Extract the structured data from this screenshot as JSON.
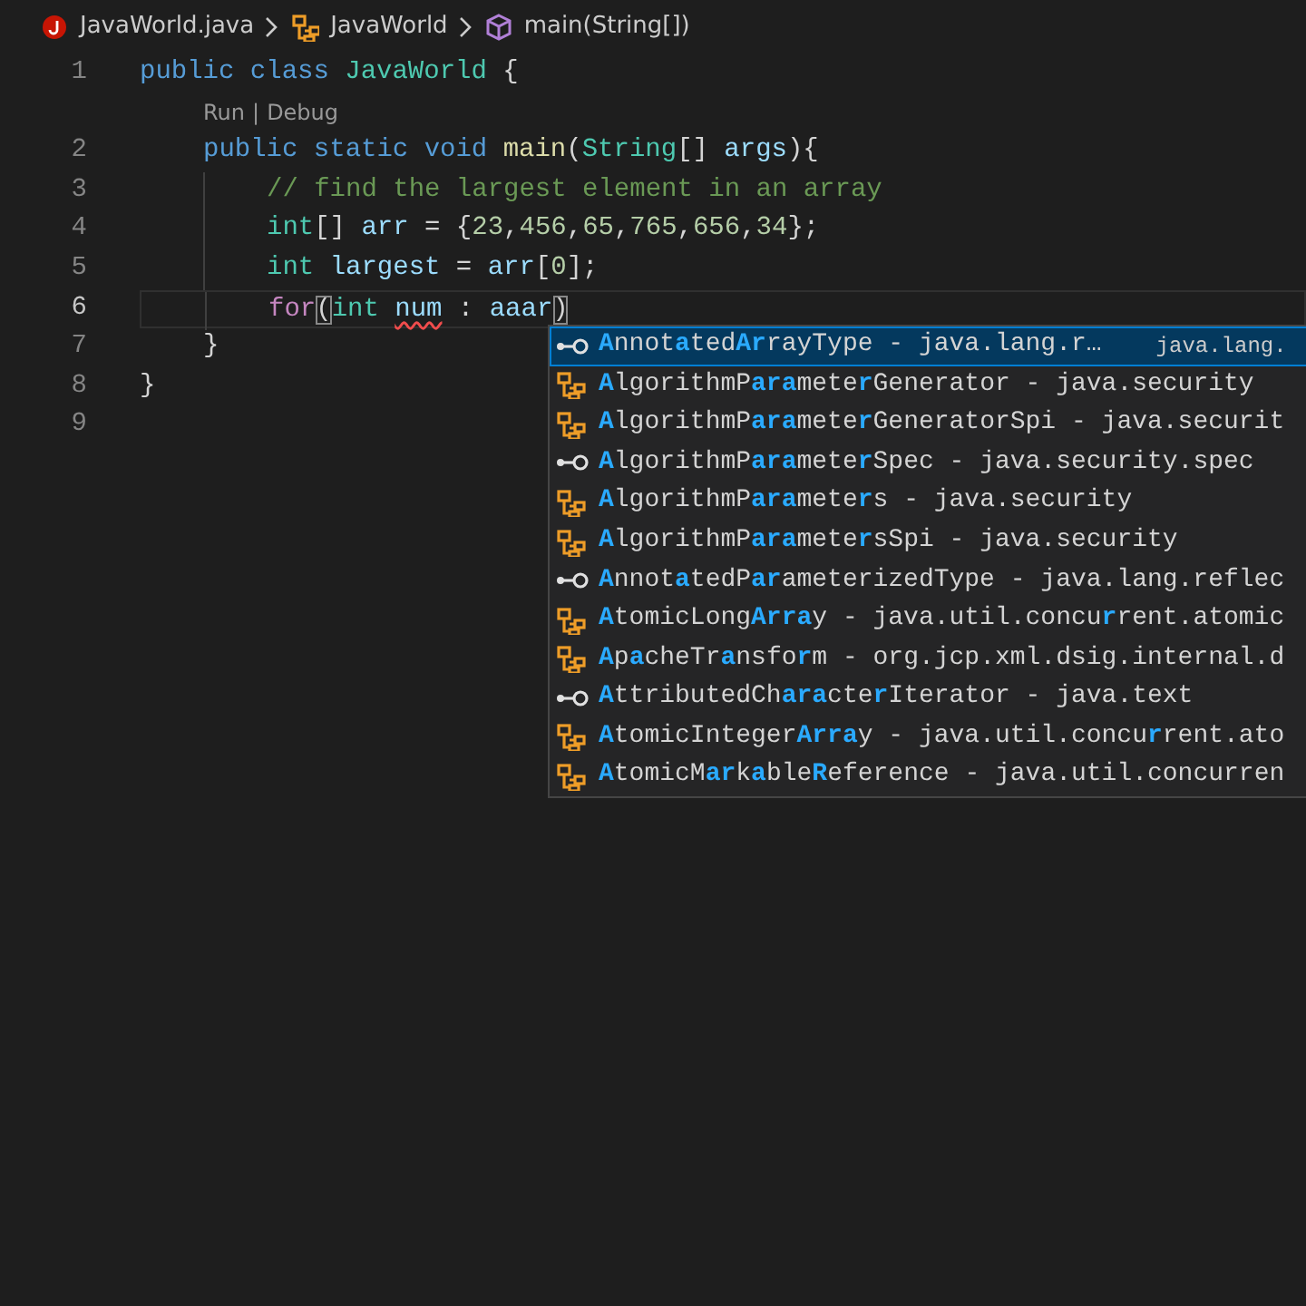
{
  "breadcrumb": [
    {
      "kind": "file",
      "label": "JavaWorld.java"
    },
    {
      "kind": "class",
      "label": "JavaWorld"
    },
    {
      "kind": "method",
      "label": "main(String[])"
    }
  ],
  "lines": [
    {
      "number": "1",
      "current": false,
      "tokens": [
        {
          "kind": "keyword",
          "text": "public class "
        },
        {
          "kind": "type",
          "text": "JavaWorld"
        },
        {
          "kind": "plain",
          "text": " {"
        }
      ],
      "children": [
        {
          "number": "2",
          "current": false,
          "code_lens": {
            "links": [
              "Run",
              "Debug"
            ],
            "separator": "|"
          },
          "tokens": [
            {
              "kind": "keyword",
              "text": "public static void "
            },
            {
              "kind": "function",
              "text": "main"
            },
            {
              "kind": "plain",
              "text": "("
            },
            {
              "kind": "type",
              "text": "String"
            },
            {
              "kind": "plain",
              "text": "[] "
            },
            {
              "kind": "variable",
              "text": "args"
            },
            {
              "kind": "plain",
              "text": "){"
            }
          ],
          "children": [
            {
              "number": "3",
              "current": false,
              "tokens": [
                {
                  "kind": "comment",
                  "text": "// find the largest element in an array"
                }
              ]
            },
            {
              "number": "4",
              "current": false,
              "tokens": [
                {
                  "kind": "type",
                  "text": "int"
                },
                {
                  "kind": "plain",
                  "text": "[] "
                },
                {
                  "kind": "variable",
                  "text": "arr"
                },
                {
                  "kind": "plain",
                  "text": " = {"
                },
                {
                  "kind": "number",
                  "text": "23"
                },
                {
                  "kind": "plain",
                  "text": ","
                },
                {
                  "kind": "number",
                  "text": "456"
                },
                {
                  "kind": "plain",
                  "text": ","
                },
                {
                  "kind": "number",
                  "text": "65"
                },
                {
                  "kind": "plain",
                  "text": ","
                },
                {
                  "kind": "number",
                  "text": "765"
                },
                {
                  "kind": "plain",
                  "text": ","
                },
                {
                  "kind": "number",
                  "text": "656"
                },
                {
                  "kind": "plain",
                  "text": ","
                },
                {
                  "kind": "number",
                  "text": "34"
                },
                {
                  "kind": "plain",
                  "text": "};"
                }
              ]
            },
            {
              "number": "5",
              "current": false,
              "tokens": [
                {
                  "kind": "type",
                  "text": "int "
                },
                {
                  "kind": "variable",
                  "text": "largest"
                },
                {
                  "kind": "plain",
                  "text": " = "
                },
                {
                  "kind": "variable",
                  "text": "arr"
                },
                {
                  "kind": "plain",
                  "text": "["
                },
                {
                  "kind": "number",
                  "text": "0"
                },
                {
                  "kind": "plain",
                  "text": "];"
                }
              ]
            },
            {
              "number": "6",
              "current": true,
              "tokens": [
                {
                  "kind": "control",
                  "text": "for"
                },
                {
                  "kind": "bracket",
                  "text": "("
                },
                {
                  "kind": "type",
                  "text": "int "
                },
                {
                  "kind": "error",
                  "text": "num"
                },
                {
                  "kind": "plain",
                  "text": " : "
                },
                {
                  "kind": "variable",
                  "text": "aaar"
                },
                {
                  "kind": "bracket",
                  "text": ")"
                }
              ]
            }
          ]
        },
        {
          "number": "7",
          "current": false,
          "tokens": [
            {
              "kind": "plain",
              "text": "}"
            }
          ]
        }
      ]
    },
    {
      "number": "8",
      "current": false,
      "tokens": [
        {
          "kind": "plain",
          "text": "}"
        }
      ]
    },
    {
      "number": "9",
      "current": false
    }
  ],
  "suggestions": [
    {
      "kind": "interface",
      "selected": true,
      "parts": [
        {
          "match": true,
          "text": "A"
        },
        {
          "match": false,
          "text": "nnot"
        },
        {
          "match": true,
          "text": "a"
        },
        {
          "match": false,
          "text": "ted"
        },
        {
          "match": true,
          "text": "Ar"
        },
        {
          "match": false,
          "text": "rayType - java.lang.r…"
        }
      ],
      "detail": "java.lang."
    },
    {
      "kind": "class",
      "selected": false,
      "parts": [
        {
          "match": true,
          "text": "A"
        },
        {
          "match": false,
          "text": "lgorithmP"
        },
        {
          "match": true,
          "text": "ara"
        },
        {
          "match": false,
          "text": "mete"
        },
        {
          "match": true,
          "text": "r"
        },
        {
          "match": false,
          "text": "Generator - java.security"
        }
      ]
    },
    {
      "kind": "class",
      "selected": false,
      "parts": [
        {
          "match": true,
          "text": "A"
        },
        {
          "match": false,
          "text": "lgorithmP"
        },
        {
          "match": true,
          "text": "ara"
        },
        {
          "match": false,
          "text": "mete"
        },
        {
          "match": true,
          "text": "r"
        },
        {
          "match": false,
          "text": "GeneratorSpi - java.securit"
        }
      ]
    },
    {
      "kind": "interface",
      "selected": false,
      "parts": [
        {
          "match": true,
          "text": "A"
        },
        {
          "match": false,
          "text": "lgorithmP"
        },
        {
          "match": true,
          "text": "ara"
        },
        {
          "match": false,
          "text": "mete"
        },
        {
          "match": true,
          "text": "r"
        },
        {
          "match": false,
          "text": "Spec - java.security.spec"
        }
      ]
    },
    {
      "kind": "class",
      "selected": false,
      "parts": [
        {
          "match": true,
          "text": "A"
        },
        {
          "match": false,
          "text": "lgorithmP"
        },
        {
          "match": true,
          "text": "ara"
        },
        {
          "match": false,
          "text": "mete"
        },
        {
          "match": true,
          "text": "r"
        },
        {
          "match": false,
          "text": "s - java.security"
        }
      ]
    },
    {
      "kind": "class",
      "selected": false,
      "parts": [
        {
          "match": true,
          "text": "A"
        },
        {
          "match": false,
          "text": "lgorithmP"
        },
        {
          "match": true,
          "text": "ara"
        },
        {
          "match": false,
          "text": "mete"
        },
        {
          "match": true,
          "text": "r"
        },
        {
          "match": false,
          "text": "sSpi - java.security"
        }
      ]
    },
    {
      "kind": "interface",
      "selected": false,
      "parts": [
        {
          "match": true,
          "text": "A"
        },
        {
          "match": false,
          "text": "nnot"
        },
        {
          "match": true,
          "text": "a"
        },
        {
          "match": false,
          "text": "tedP"
        },
        {
          "match": true,
          "text": "ar"
        },
        {
          "match": false,
          "text": "ameterizedType - java.lang.reflec"
        }
      ]
    },
    {
      "kind": "class",
      "selected": false,
      "parts": [
        {
          "match": true,
          "text": "A"
        },
        {
          "match": false,
          "text": "tomicLong"
        },
        {
          "match": true,
          "text": "Arra"
        },
        {
          "match": false,
          "text": "y - java.util.concu"
        },
        {
          "match": true,
          "text": "r"
        },
        {
          "match": false,
          "text": "rent.atomic"
        }
      ]
    },
    {
      "kind": "class",
      "selected": false,
      "parts": [
        {
          "match": true,
          "text": "A"
        },
        {
          "match": false,
          "text": "p"
        },
        {
          "match": true,
          "text": "a"
        },
        {
          "match": false,
          "text": "cheTr"
        },
        {
          "match": true,
          "text": "a"
        },
        {
          "match": false,
          "text": "nsfo"
        },
        {
          "match": true,
          "text": "r"
        },
        {
          "match": false,
          "text": "m - org.jcp.xml.dsig.internal.d"
        }
      ]
    },
    {
      "kind": "interface",
      "selected": false,
      "parts": [
        {
          "match": true,
          "text": "A"
        },
        {
          "match": false,
          "text": "ttributedCh"
        },
        {
          "match": true,
          "text": "ara"
        },
        {
          "match": false,
          "text": "cte"
        },
        {
          "match": true,
          "text": "r"
        },
        {
          "match": false,
          "text": "Iterator - java.text"
        }
      ]
    },
    {
      "kind": "class",
      "selected": false,
      "parts": [
        {
          "match": true,
          "text": "A"
        },
        {
          "match": false,
          "text": "tomicInteger"
        },
        {
          "match": true,
          "text": "Arra"
        },
        {
          "match": false,
          "text": "y - java.util.concu"
        },
        {
          "match": true,
          "text": "r"
        },
        {
          "match": false,
          "text": "rent.ato"
        }
      ]
    },
    {
      "kind": "class",
      "selected": false,
      "parts": [
        {
          "match": true,
          "text": "A"
        },
        {
          "match": false,
          "text": "tomicM"
        },
        {
          "match": true,
          "text": "ar"
        },
        {
          "match": false,
          "text": "k"
        },
        {
          "match": true,
          "text": "a"
        },
        {
          "match": false,
          "text": "ble"
        },
        {
          "match": true,
          "text": "R"
        },
        {
          "match": false,
          "text": "eference - java.util.concurren"
        }
      ]
    }
  ]
}
